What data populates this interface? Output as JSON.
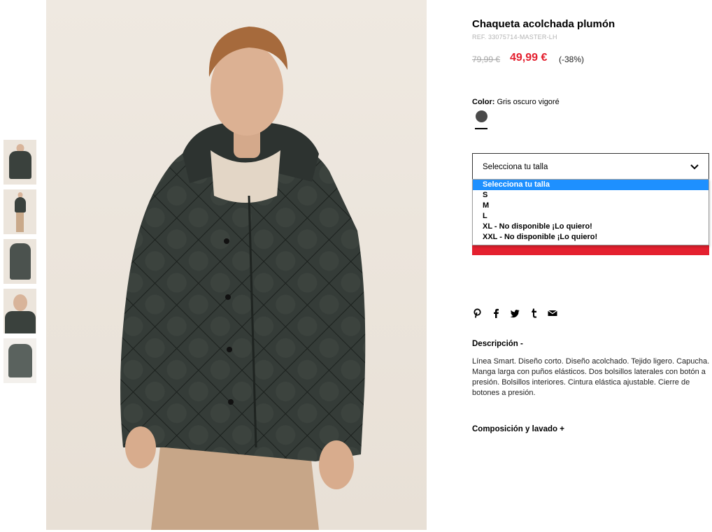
{
  "product": {
    "title": "Chaqueta acolchada plumón",
    "ref": "REF. 33075714-MASTER-LH",
    "old_price": "79,99 €",
    "new_price": "49,99 €",
    "discount": "(-38%)"
  },
  "color": {
    "label": "Color:",
    "value": "Gris oscuro vigoré",
    "swatch_hex": "#4a4a4a"
  },
  "size_select": {
    "value": "Selecciona tu talla",
    "options": [
      "Selecciona tu talla",
      "S",
      "M",
      "L",
      "XL - No disponible ¡Lo quiero!",
      "XXL - No disponible ¡Lo quiero!"
    ]
  },
  "share_icons": [
    "pinterest-icon",
    "facebook-icon",
    "twitter-icon",
    "tumblr-icon",
    "email-icon"
  ],
  "description": {
    "heading": "Descripción  -",
    "text": "Línea Smart. Diseño corto. Diseño acolchado. Tejido ligero. Capucha. Manga larga con puños elásticos. Dos bolsillos laterales con botón a presión. Bolsillos interiores. Cintura elástica ajustable. Cierre de botones a presión."
  },
  "composition": {
    "heading": "Composición y lavado  +"
  },
  "colors": {
    "accent_red": "#e4202f",
    "selected_option": "#1e90ff"
  }
}
